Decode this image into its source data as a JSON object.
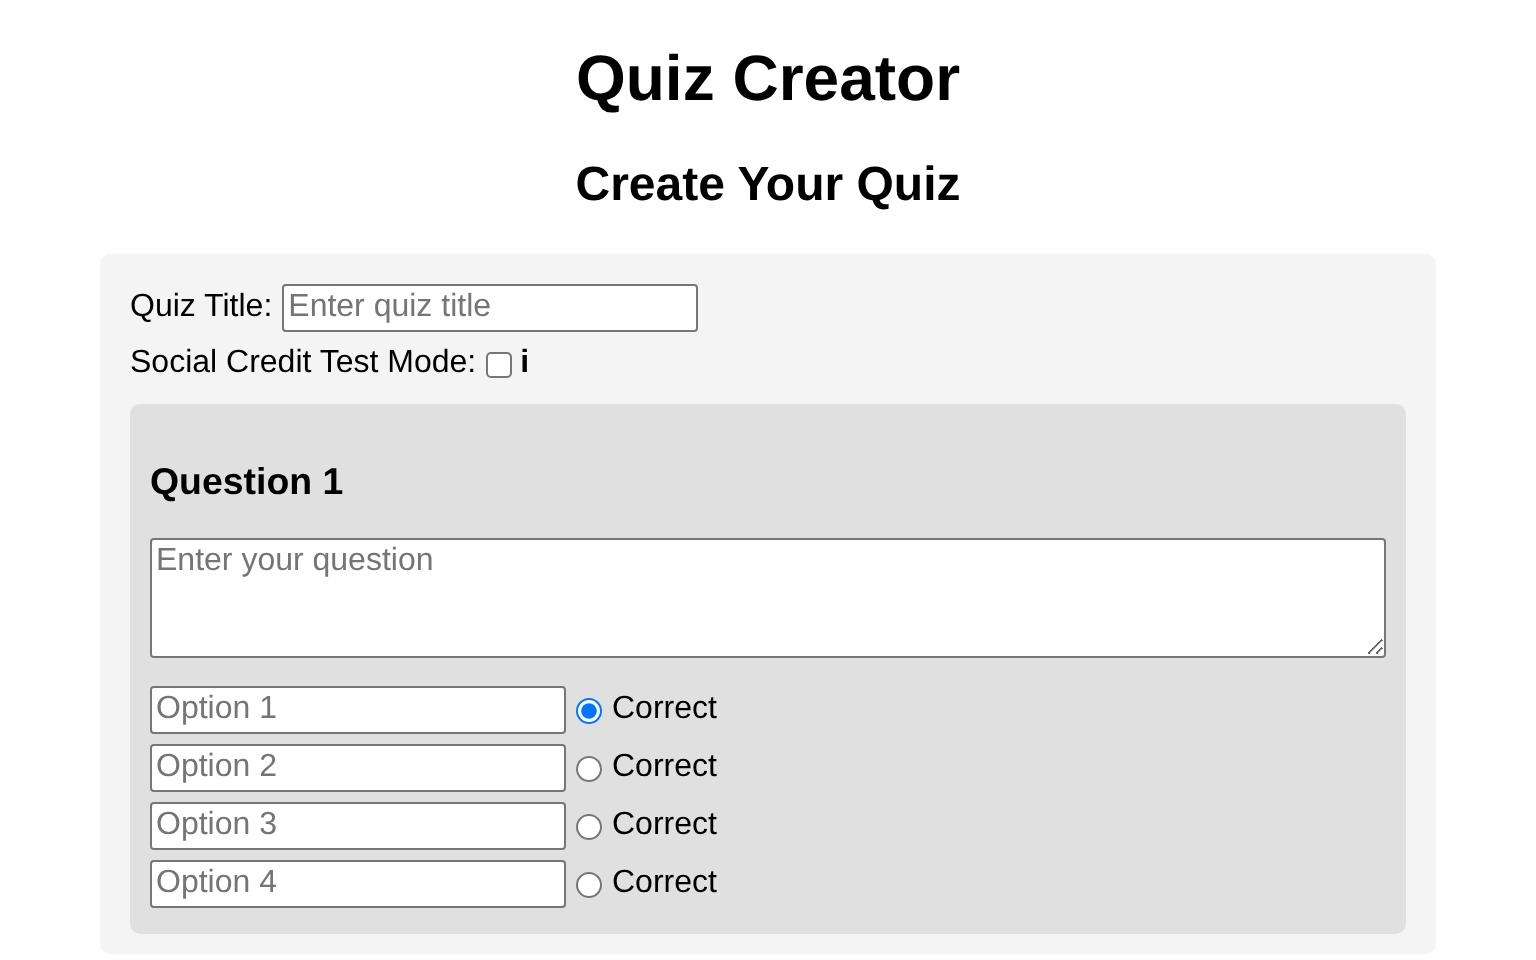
{
  "title": "Quiz Creator",
  "subtitle": "Create Your Quiz",
  "quiz_title": {
    "label": "Quiz Title:",
    "placeholder": "Enter quiz title"
  },
  "social_credit": {
    "label": "Social Credit Test Mode:",
    "checked": false,
    "info": "i"
  },
  "questions": [
    {
      "heading": "Question 1",
      "placeholder": "Enter your question",
      "options": [
        {
          "placeholder": "Option 1",
          "selected": true,
          "label": "Correct"
        },
        {
          "placeholder": "Option 2",
          "selected": false,
          "label": "Correct"
        },
        {
          "placeholder": "Option 3",
          "selected": false,
          "label": "Correct"
        },
        {
          "placeholder": "Option 4",
          "selected": false,
          "label": "Correct"
        }
      ]
    }
  ]
}
